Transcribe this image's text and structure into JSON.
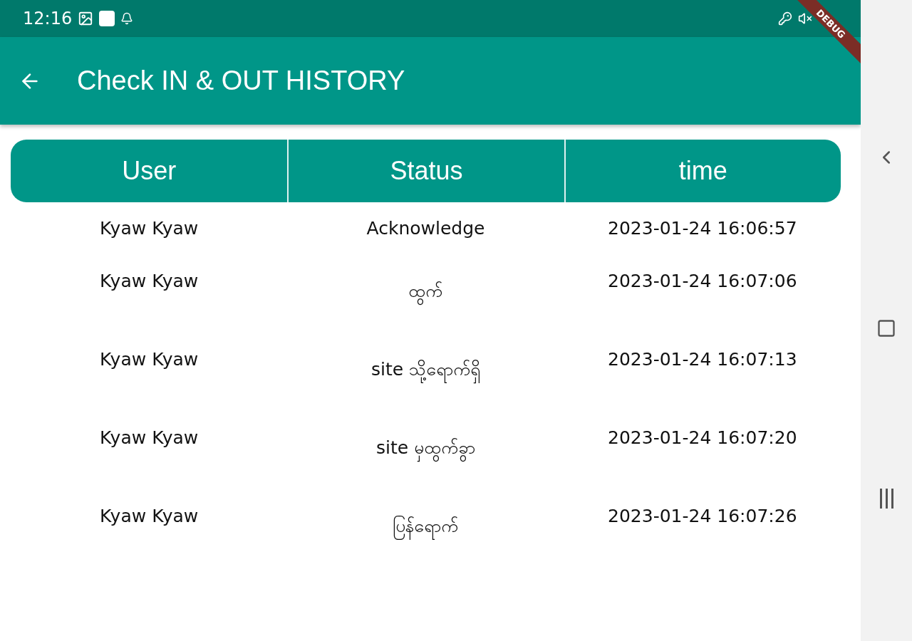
{
  "status_bar": {
    "time": "12:16"
  },
  "debug_banner": {
    "label": "DEBUG"
  },
  "app_bar": {
    "title": "Check IN & OUT HISTORY"
  },
  "table": {
    "columns": [
      "User",
      "Status",
      "time"
    ],
    "rows": [
      {
        "user": "Kyaw Kyaw",
        "status": "Acknowledge",
        "time": "2023-01-24 16:06:57"
      },
      {
        "user": "Kyaw Kyaw",
        "status": "ထွက်",
        "time": "2023-01-24 16:07:06"
      },
      {
        "user": "Kyaw Kyaw",
        "status": "site သို့ရောက်ရှိ",
        "time": "2023-01-24 16:07:13"
      },
      {
        "user": "Kyaw Kyaw",
        "status": "site မှထွက်ခွာ",
        "time": "2023-01-24 16:07:20"
      },
      {
        "user": "Kyaw Kyaw",
        "status": "ပြန်ရောက်",
        "time": "2023-01-24 16:07:26"
      }
    ]
  }
}
